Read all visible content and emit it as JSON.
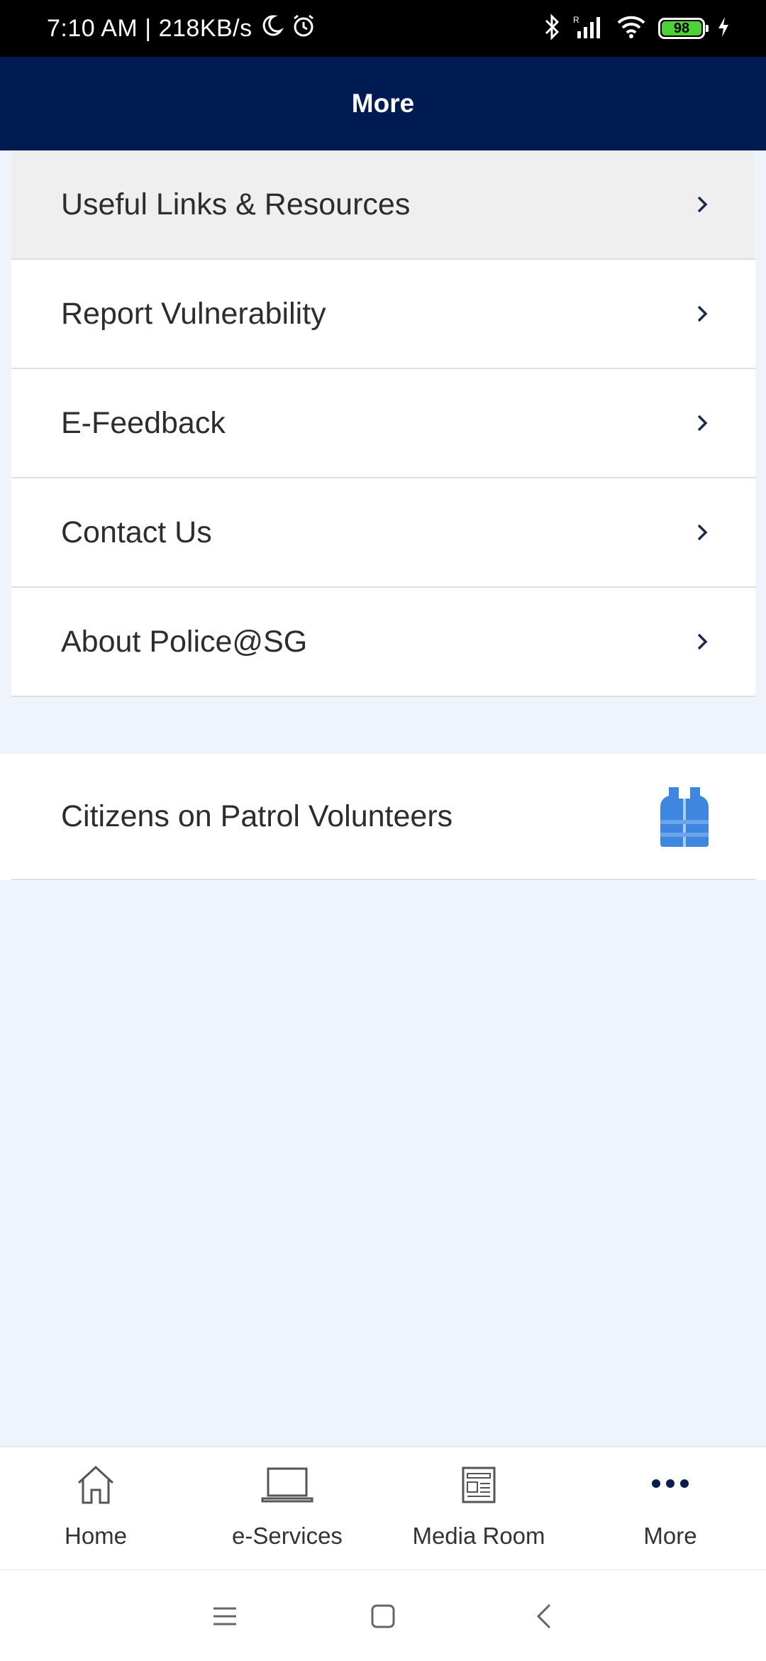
{
  "status_bar": {
    "time": "7:10 AM",
    "separator": "|",
    "speed": "218KB/s",
    "battery": "98"
  },
  "header": {
    "title": "More"
  },
  "menu": {
    "items": [
      {
        "label": "Useful Links & Resources"
      },
      {
        "label": "Report Vulnerability"
      },
      {
        "label": "E-Feedback"
      },
      {
        "label": "Contact Us"
      },
      {
        "label": "About Police@SG"
      }
    ]
  },
  "cop": {
    "label": "Citizens on Patrol Volunteers",
    "icon": "vest-icon"
  },
  "bottom_nav": {
    "items": [
      {
        "label": "Home",
        "icon": "home-icon"
      },
      {
        "label": "e-Services",
        "icon": "laptop-icon"
      },
      {
        "label": "Media Room",
        "icon": "newspaper-icon"
      },
      {
        "label": "More",
        "icon": "more-dots-icon"
      }
    ]
  },
  "colors": {
    "header_bg": "#001b52",
    "page_bg": "#eff4fc",
    "vest_blue": "#3f86e0",
    "battery_green": "#4cd137"
  }
}
